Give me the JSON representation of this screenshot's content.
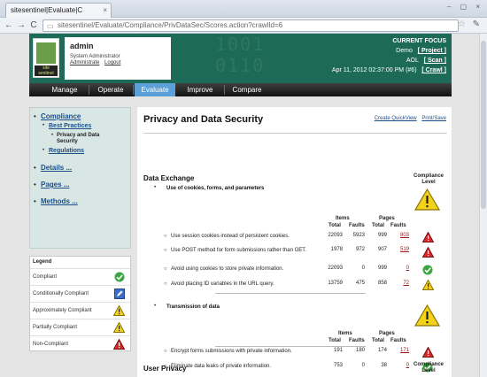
{
  "browser": {
    "tab_title": "sitesentinel|Evaluate|C",
    "tab_close": "×",
    "window_controls": "– ▢ ×",
    "back": "←",
    "forward": "→",
    "reload": "C",
    "url": "sitesentinel/Evaluate/Compliance/PrivDataSec/Scores.action?crawlId=6"
  },
  "header": {
    "logo_text": "site sentinel",
    "user_name": "admin",
    "user_role": "System Administrator",
    "user_links": [
      "Administrate",
      "Logout"
    ],
    "focus_title": "CURRENT FOCUS",
    "focus_rows": [
      {
        "label": "Demo",
        "link": "[ Project ]"
      },
      {
        "label": "AOL",
        "link": "[ Scan ]"
      },
      {
        "label": "Apr 11, 2012 02:37:00 PM (#6)",
        "link": "[ Crawl ]"
      }
    ]
  },
  "nav": {
    "items": [
      "Manage",
      "Operate",
      "Evaluate",
      "Improve",
      "Compare"
    ],
    "active": "Evaluate"
  },
  "sidebar": {
    "compliance": "Compliance",
    "best_practices": "Best Practices",
    "privacy": "Privacy and Data Security",
    "regulations": "Regulations",
    "details": "Details ...",
    "pages": "Pages ...",
    "methods": "Methods ..."
  },
  "legend": {
    "title": "Legend",
    "rows": [
      "Compliant",
      "Conditionally Compliant",
      "Approximately Compliant",
      "Partially Compliant",
      "Non-Compliant"
    ]
  },
  "content": {
    "title": "Privacy and Data Security",
    "actions": [
      "Create QuickView",
      "Print/Save"
    ],
    "compliance_header_1": "Compliance",
    "compliance_header_2": "Level",
    "sections": [
      {
        "heading": "Data Exchange"
      },
      {
        "heading": "User Privacy"
      }
    ],
    "group1": {
      "title": "Use of cookies, forms, and parameters",
      "items_header": "Items",
      "pages_header": "Pages",
      "cols": [
        "Total",
        "Faults",
        "Total",
        "Faults"
      ],
      "rows": [
        {
          "text": "Use session cookies instead of persistent cookies.",
          "it": "22093",
          "if": "5923",
          "pt": "999",
          "pf": "803"
        },
        {
          "text": "Use POST method for form submissions rather than GET.",
          "it": "1978",
          "if": "972",
          "pt": "907",
          "pf": "519"
        },
        {
          "text": "Avoid using cookies to store private information.",
          "it": "22093",
          "if": "0",
          "pt": "999",
          "pf": "0"
        },
        {
          "text": "Avoid placing ID variables in the URL query.",
          "it": "13759",
          "if": "475",
          "pt": "858",
          "pf": "72"
        }
      ]
    },
    "group2": {
      "title": "Transmission of data",
      "items_header": "Items",
      "pages_header": "Pages",
      "cols": [
        "Total",
        "Faults",
        "Total",
        "Faults"
      ],
      "rows": [
        {
          "text": "Encrypt forms submissions with private information.",
          "it": "191",
          "if": "180",
          "pt": "174",
          "pf": "171"
        },
        {
          "text": "Eliminate data leaks of private information.",
          "it": "753",
          "if": "0",
          "pt": "38",
          "pf": "0"
        }
      ]
    }
  },
  "colors": {
    "header_green": "#1d6a58",
    "nav_active": "#5ba0d9",
    "link_red": "#a01818",
    "link_blue": "#1c4f8a"
  }
}
